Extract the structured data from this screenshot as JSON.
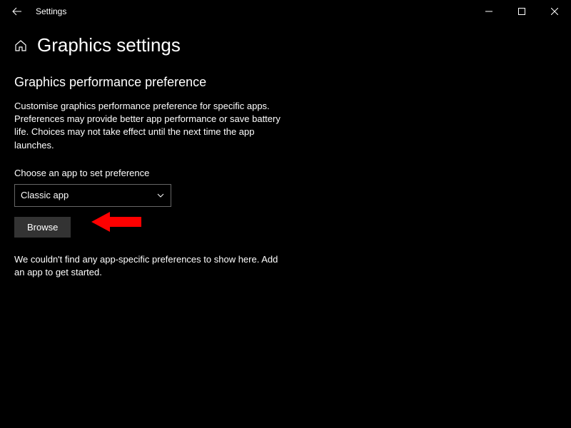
{
  "titlebar": {
    "title": "Settings"
  },
  "header": {
    "page_title": "Graphics settings"
  },
  "main": {
    "section_title": "Graphics performance preference",
    "description": "Customise graphics performance preference for specific apps. Preferences may provide better app performance or save battery life. Choices may not take effect until the next time the app launches.",
    "select_label": "Choose an app to set preference",
    "select_value": "Classic app",
    "browse_label": "Browse",
    "empty_message": "We couldn't find any app-specific preferences to show here. Add an app to get started."
  }
}
